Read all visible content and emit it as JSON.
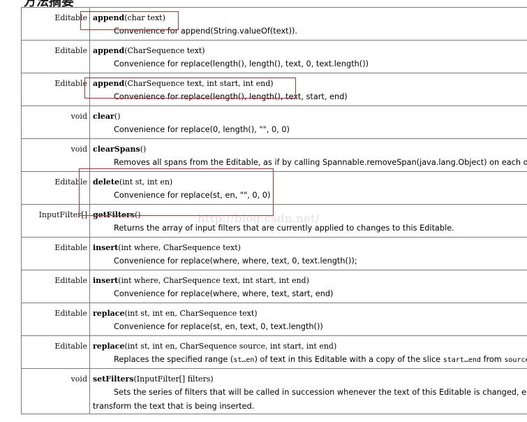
{
  "section_heading": "方法摘要",
  "methods": [
    {
      "type": "Editable",
      "name": "append",
      "params": "(char text)",
      "description": "Convenience for append(String.valueOf(text))."
    },
    {
      "type": "Editable",
      "name": "append",
      "params": "(CharSequence text)",
      "description": "Convenience for replace(length(), length(), text, 0, text.length())"
    },
    {
      "type": "Editable",
      "name": "append",
      "params": "(CharSequence text, int start, int end)",
      "description": "Convenience for replace(length(), length(), text, start, end)"
    },
    {
      "type": "void",
      "name": "clear",
      "params": "()",
      "description": "Convenience for replace(0, length(), \"\", 0, 0)"
    },
    {
      "type": "void",
      "name": "clearSpans",
      "params": "()",
      "description": "Removes all spans from the Editable, as if by calling Spannable.removeSpan(java.lang.Object) on each of them."
    },
    {
      "type": "Editable",
      "name": "delete",
      "params": "(int st, int en)",
      "description": "Convenience for replace(st, en, \"\", 0, 0)"
    },
    {
      "type": "InputFilter[]",
      "name": "getFilters",
      "params": "()",
      "description": "Returns the array of input filters that are currently applied to changes to this Editable."
    },
    {
      "type": "Editable",
      "name": "insert",
      "params": "(int where, CharSequence text)",
      "description": "Convenience for replace(where, where, text, 0, text.length());"
    },
    {
      "type": "Editable",
      "name": "insert",
      "params": "(int where, CharSequence text, int start, int end)",
      "description": "Convenience for replace(where, where, text, start, end)"
    },
    {
      "type": "Editable",
      "name": "replace",
      "params": "(int st, int en, CharSequence text)",
      "description": "Convenience for replace(st, en, text, 0, text.length())"
    },
    {
      "type": "Editable",
      "name": "replace",
      "params": "(int st, int en, CharSequence source, int start, int end)",
      "description_parts": {
        "pre": "Replaces the specified range (",
        "code1": "st…en",
        "mid": ") of text in this Editable with a copy of the slice ",
        "code2": "start…end",
        "mid2": " from ",
        "code3": "source",
        "post": "."
      }
    },
    {
      "type": "void",
      "name": "setFilters",
      "params": "(InputFilter[] filters)",
      "description_line1": "Sets the series of filters that will be called in succession whenever the text of this Editable is changed, each of which has the opportunity to",
      "description_line2": "transform the text that is being inserted."
    }
  ],
  "watermark": "http://blog.csdn.net/",
  "highlight_color": "#d9262b"
}
